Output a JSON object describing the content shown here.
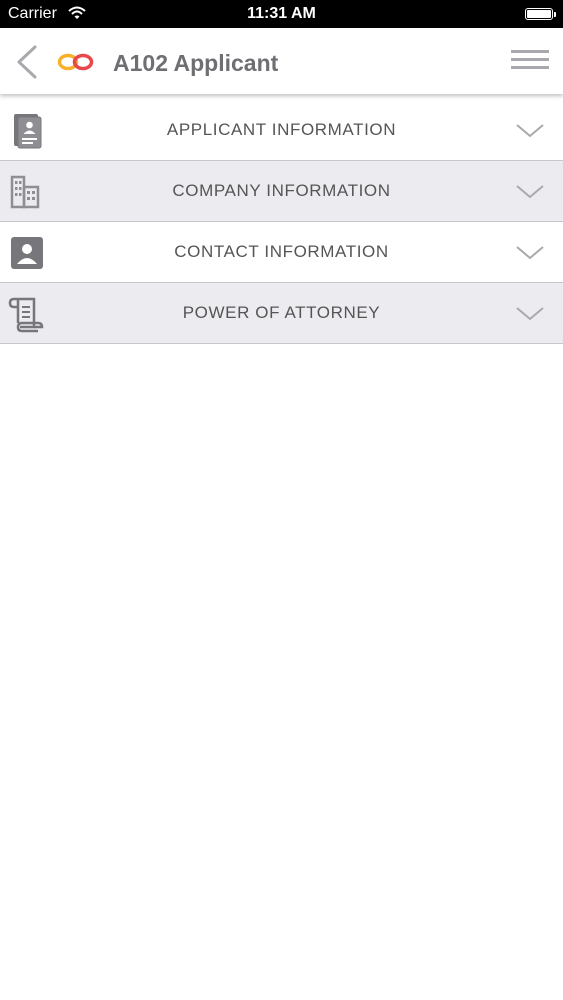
{
  "status_bar": {
    "carrier": "Carrier",
    "time": "11:31 AM"
  },
  "header": {
    "title": "A102 Applicant"
  },
  "sections": [
    {
      "label": "APPLICANT INFORMATION",
      "icon": "document-person-icon"
    },
    {
      "label": "COMPANY INFORMATION",
      "icon": "building-icon"
    },
    {
      "label": "CONTACT INFORMATION",
      "icon": "contact-card-icon"
    },
    {
      "label": "POWER OF ATTORNEY",
      "icon": "scroll-icon"
    }
  ],
  "colors": {
    "logo_left": "#f7b12b",
    "logo_right": "#e8484a",
    "text": "#555555",
    "shaded_row": "#ececf0"
  }
}
